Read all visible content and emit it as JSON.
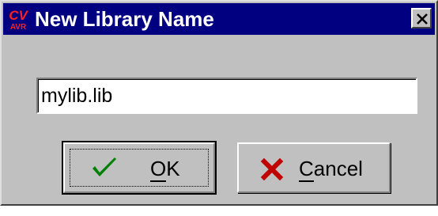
{
  "dialog": {
    "title": "New Library Name",
    "app_icon": "cvavr-logo-icon",
    "app_icon_text_top": "CV",
    "app_icon_text_bottom": "AVR",
    "close_icon": "close-icon"
  },
  "input": {
    "value": "mylib.lib"
  },
  "buttons": {
    "ok": {
      "label": "OK",
      "mnemonic": "O",
      "icon": "checkmark-icon",
      "icon_color": "#008000",
      "focused": true
    },
    "cancel": {
      "label": "Cancel",
      "mnemonic": "C",
      "icon": "x-cross-icon",
      "icon_color": "#c00000"
    }
  },
  "colors": {
    "titlebar": "#000080",
    "window": "#c0c0c0"
  }
}
